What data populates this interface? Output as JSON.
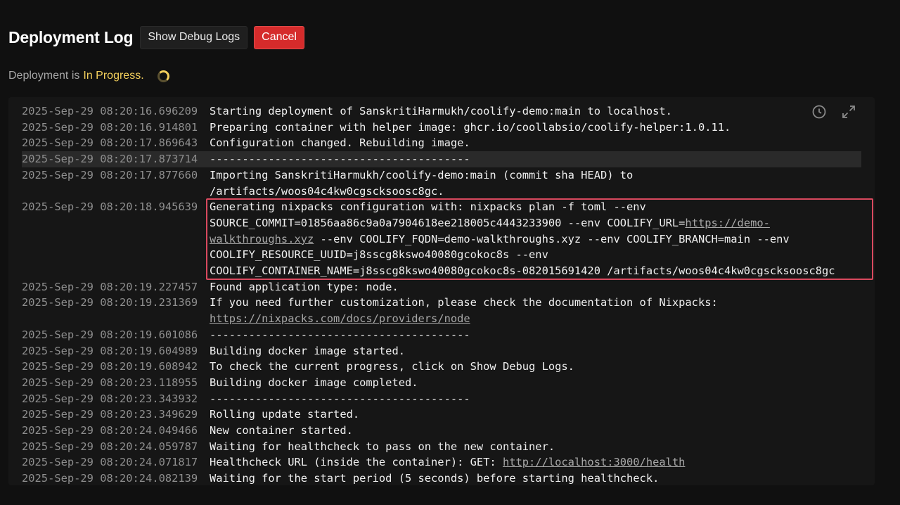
{
  "header": {
    "title": "Deployment Log",
    "debug_label": "Show Debug Logs",
    "cancel_label": "Cancel"
  },
  "status": {
    "prefix": "Deployment is",
    "state": "In Progress."
  },
  "colors": {
    "accent_yellow": "#f3cf5c",
    "cancel_red": "#d52b2b",
    "highlight_box": "#d9495e"
  },
  "panel": {
    "icons": [
      "clock-icon",
      "expand-icon"
    ]
  },
  "logs": [
    {
      "ts": "2025-Sep-29 08:20:16.696209",
      "msg": "Starting deployment of SanskritiHarmukh/coolify-demo:main to localhost."
    },
    {
      "ts": "2025-Sep-29 08:20:16.914801",
      "msg": "Preparing container with helper image: ghcr.io/coollabsio/coolify-helper:1.0.11."
    },
    {
      "ts": "2025-Sep-29 08:20:17.869643",
      "msg": "Configuration changed. Rebuilding image."
    },
    {
      "ts": "2025-Sep-29 08:20:17.873714",
      "msg": "----------------------------------------"
    },
    {
      "ts": "2025-Sep-29 08:20:17.877660",
      "msg": "Importing SanskritiHarmukh/coolify-demo:main (commit sha HEAD) to /artifacts/woos04c4kw0cgscksoosc8gc."
    },
    {
      "ts": "2025-Sep-29 08:20:18.945639",
      "msg_pre": "Generating nixpacks configuration with: nixpacks plan -f toml --env SOURCE_COMMIT=01856aa86c9a0a7904618ee218005c4443233900 --env COOLIFY_URL=",
      "link": "https://demo-walkthroughs.xyz",
      "msg_post": " --env COOLIFY_FQDN=demo-walkthroughs.xyz --env COOLIFY_BRANCH=main --env COOLIFY_RESOURCE_UUID=j8sscg8kswo40080gcokoc8s --env COOLIFY_CONTAINER_NAME=j8sscg8kswo40080gcokoc8s-082015691420 /artifacts/woos04c4kw0cgscksoosc8gc"
    },
    {
      "ts": "2025-Sep-29 08:20:19.227457",
      "msg": "Found application type: node."
    },
    {
      "ts": "2025-Sep-29 08:20:19.231369",
      "msg_pre": "If you need further customization, please check the documentation of Nixpacks: ",
      "link": "https://nixpacks.com/docs/providers/node",
      "msg_post": ""
    },
    {
      "ts": "2025-Sep-29 08:20:19.601086",
      "msg": "----------------------------------------"
    },
    {
      "ts": "2025-Sep-29 08:20:19.604989",
      "msg": "Building docker image started."
    },
    {
      "ts": "2025-Sep-29 08:20:19.608942",
      "msg": "To check the current progress, click on Show Debug Logs."
    },
    {
      "ts": "2025-Sep-29 08:20:23.118955",
      "msg": "Building docker image completed."
    },
    {
      "ts": "2025-Sep-29 08:20:23.343932",
      "msg": "----------------------------------------"
    },
    {
      "ts": "2025-Sep-29 08:20:23.349629",
      "msg": "Rolling update started."
    },
    {
      "ts": "2025-Sep-29 08:20:24.049466",
      "msg": "New container started."
    },
    {
      "ts": "2025-Sep-29 08:20:24.059787",
      "msg": "Waiting for healthcheck to pass on the new container."
    },
    {
      "ts": "2025-Sep-29 08:20:24.071817",
      "msg_pre": "Healthcheck URL (inside the container): GET: ",
      "link": "http://localhost:3000/health",
      "msg_post": ""
    },
    {
      "ts": "2025-Sep-29 08:20:24.082139",
      "msg": "Waiting for the start period (5 seconds) before starting healthcheck."
    }
  ]
}
